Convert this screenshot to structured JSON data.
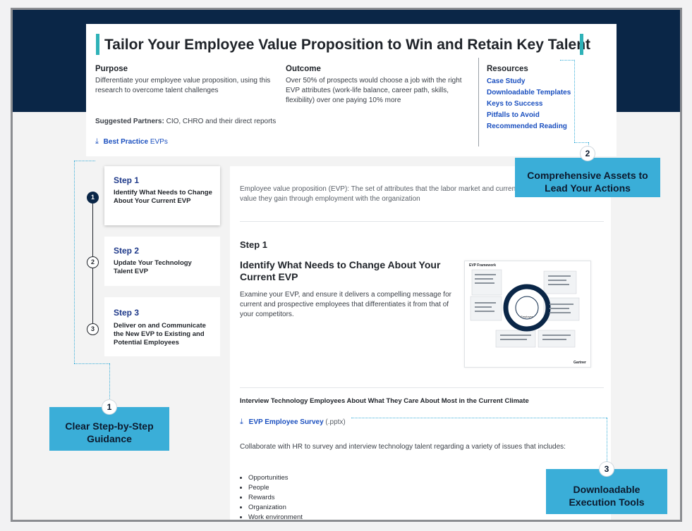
{
  "hero": {
    "title": "Tailor Your Employee Value Proposition to Win and Retain Key Talent",
    "purpose_label": "Purpose",
    "purpose_text": "Differentiate your employee value proposition, using this research to overcome talent challenges",
    "outcome_label": "Outcome",
    "outcome_text": "Over 50% of prospects would choose a job with the right EVP attributes (work-life balance, career path, skills, flexibility) over one paying 10% more",
    "partners_label": "Suggested Partners:",
    "partners_text": "CIO, CHRO and their direct reports",
    "best_practice_link": "Best Practice",
    "best_practice_suffix": "EVPs",
    "resources_label": "Resources",
    "resources": [
      "Case Study",
      "Downloadable Templates",
      "Keys to Success",
      "Pitfalls to Avoid",
      "Recommended Reading"
    ]
  },
  "steps": [
    {
      "num": "1",
      "title": "Step 1",
      "desc": "Identify What Needs to Change About Your Current EVP"
    },
    {
      "num": "2",
      "title": "Step 2",
      "desc": "Update Your Technology Talent EVP"
    },
    {
      "num": "3",
      "title": "Step 3",
      "desc": "Deliver on and Communicate the New EVP to Existing and Potential Employees"
    }
  ],
  "content": {
    "definition": "Employee value proposition (EVP): The set of attributes that the labor market and current employees perceive as the value they gain through employment with the organization",
    "step_label": "Step 1",
    "heading": "Identify What Needs to Change About Your Current EVP",
    "body": "Examine your EVP, and ensure it delivers a compelling message for current and prospective employees that differentiates it from that of your competitors.",
    "framework_title": "EVP Framework",
    "framework_center": "Employee",
    "framework_brand": "Gartner",
    "interview_heading": "Interview Technology Employees About What They Care About Most in the Current Climate",
    "survey_link": "EVP Employee Survey",
    "survey_ext": "(.pptx)",
    "collaborate_text": "Collaborate with HR to survey and interview technology talent regarding a variety of issues that includes:",
    "bullets": [
      "Opportunities",
      "People",
      "Rewards",
      "Organization",
      "Work environment"
    ]
  },
  "callouts": [
    {
      "num": "1",
      "text": "Clear Step-by-Step Guidance"
    },
    {
      "num": "2",
      "text": "Comprehensive Assets to Lead Your Actions"
    },
    {
      "num": "3",
      "text": "Downloadable Execution Tools"
    }
  ],
  "colors": {
    "navy": "#0a2647",
    "accent": "#2fb2b8",
    "callout": "#3aaed8",
    "link": "#1a4fbf"
  }
}
